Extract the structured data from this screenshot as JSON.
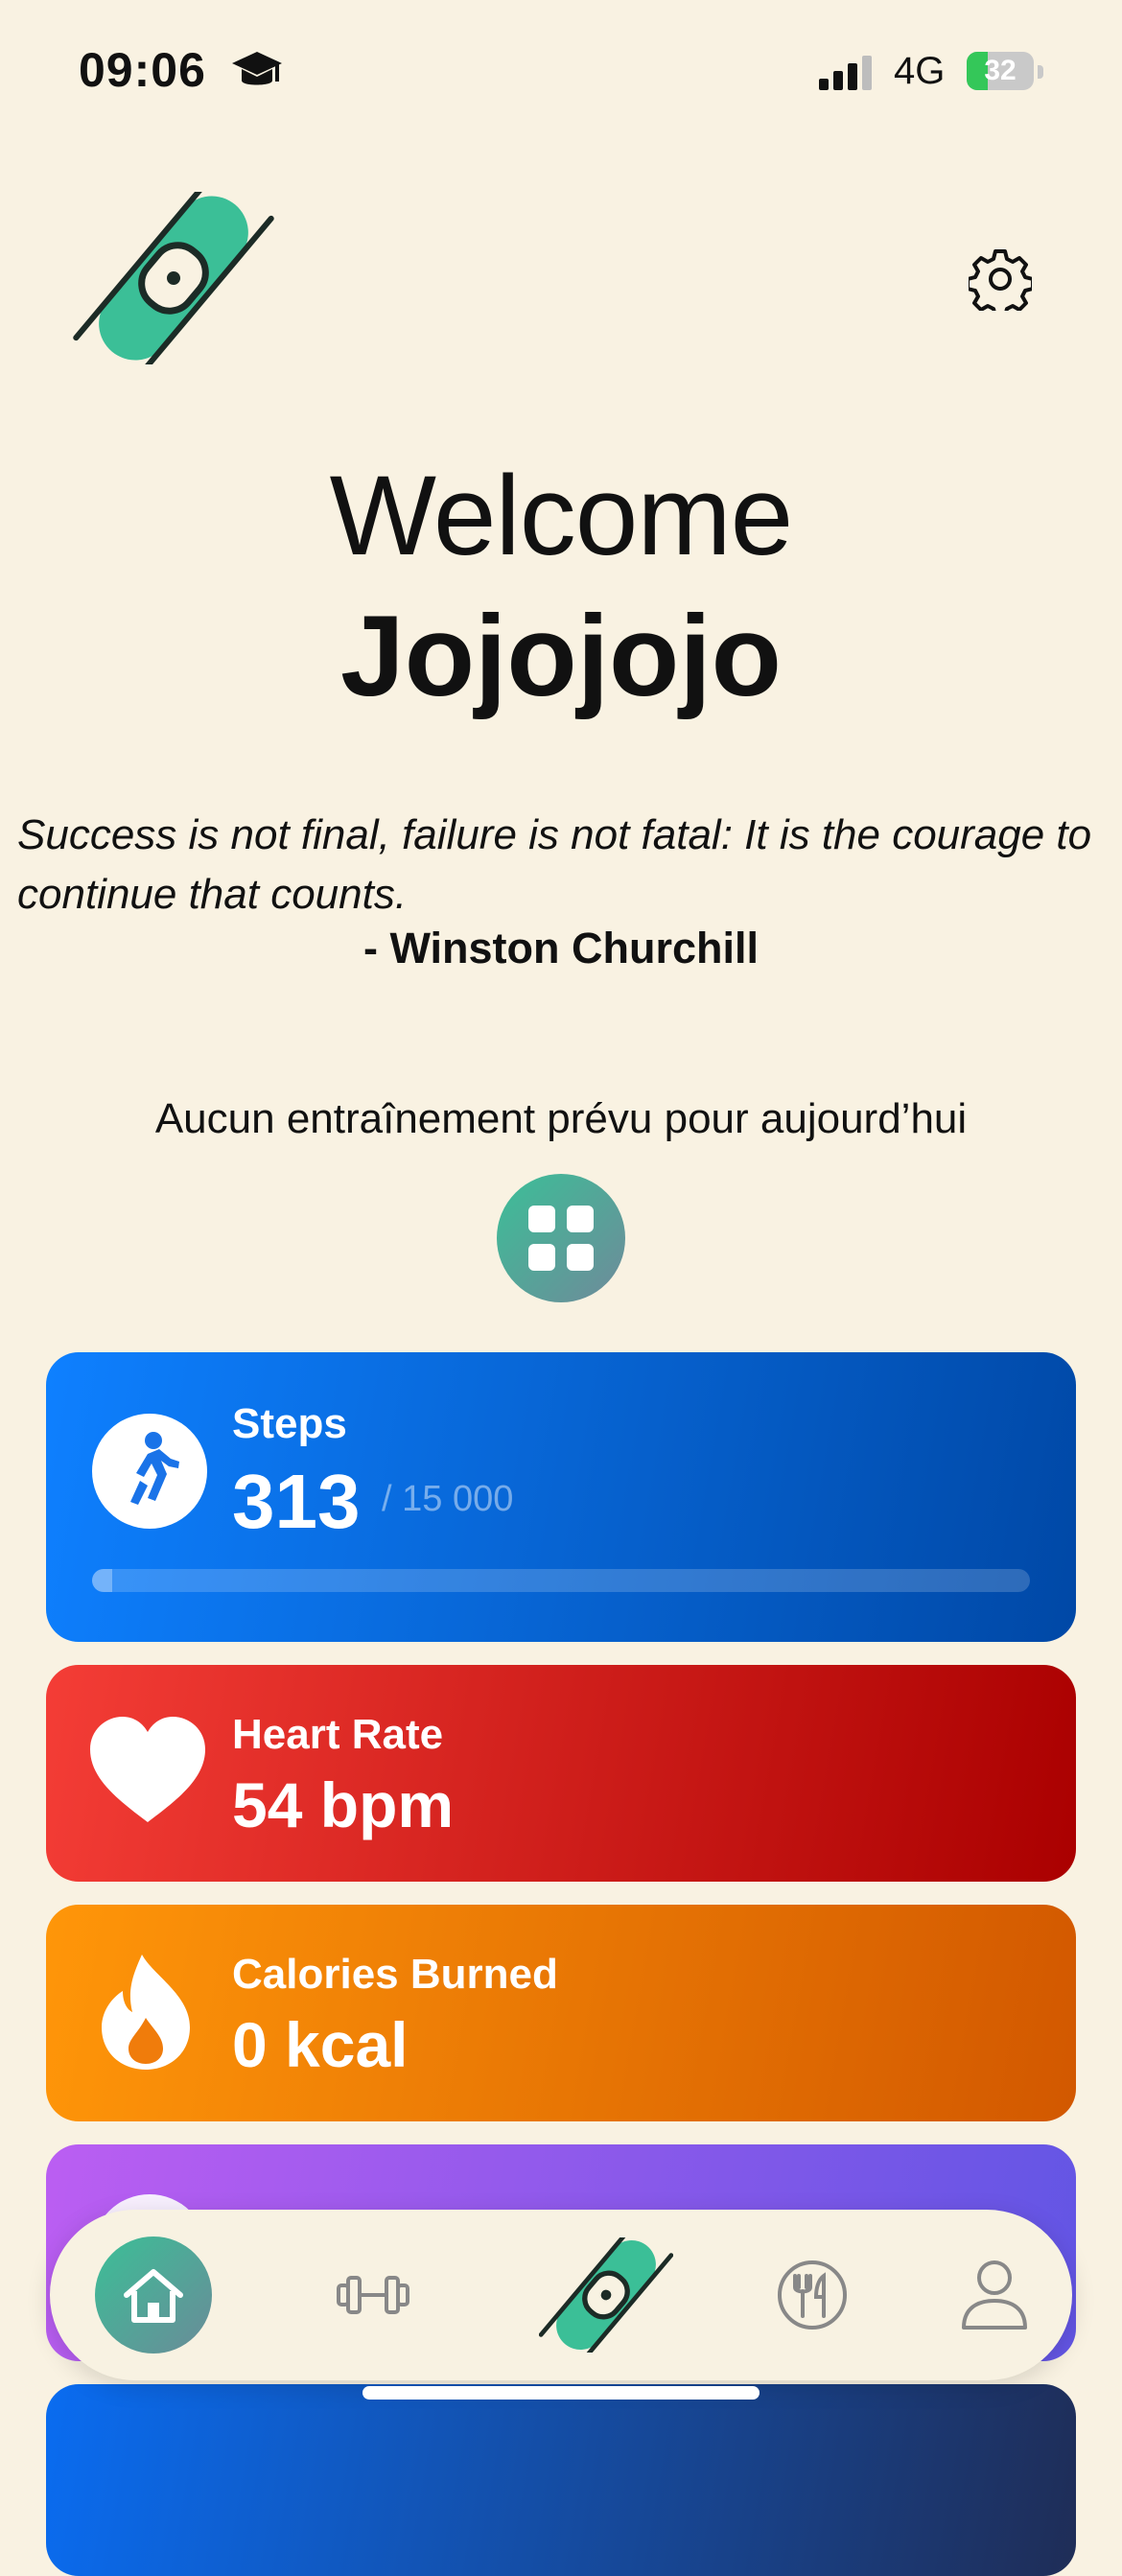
{
  "status_bar": {
    "time": "09:06",
    "network": "4G",
    "battery": "32"
  },
  "welcome": {
    "greeting": "Welcome",
    "username": "Jojojojo"
  },
  "quote": {
    "text": "Success is not final, failure is not fatal: It is the courage to continue that counts.",
    "author": "- Winston Churchill"
  },
  "training": {
    "empty_message": "Aucun entraînement prévu pour aujourd’hui"
  },
  "cards": {
    "steps": {
      "label": "Steps",
      "value": "313",
      "goal": "/ 15 000",
      "progress": 0.021
    },
    "heart_rate": {
      "label": "Heart Rate",
      "value": "54 bpm"
    },
    "calories": {
      "label": "Calories Burned",
      "value": "0 kcal"
    }
  },
  "colors": {
    "background": "#f9f2e2",
    "accent_green": "#3bbf97",
    "steps_blue": "#0e80ff",
    "heart_red": "#f43d36",
    "calories_orange": "#ff9609",
    "sleep_purple": "#bb5ef2"
  },
  "tab_bar": {
    "items": [
      "home-icon",
      "dumbbell-icon",
      "app-logo-icon",
      "fork-knife-icon",
      "person-icon"
    ],
    "active": "home-icon"
  }
}
